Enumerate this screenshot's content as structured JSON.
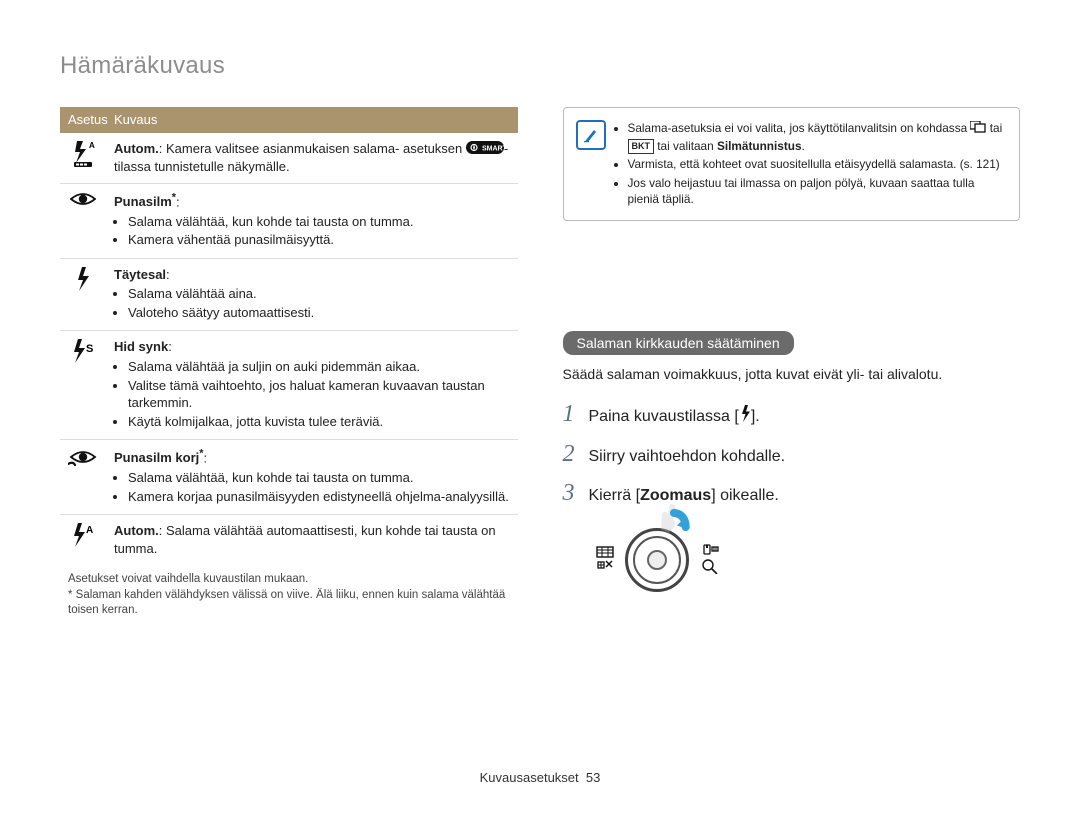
{
  "page_title": "Hämäräkuvaus",
  "table": {
    "head_option": "Asetus",
    "head_desc": "Kuvaus",
    "rows": {
      "auto": {
        "label": "Autom.",
        "text1": ": Kamera valitsee asianmukaisen salama- asetuksen ",
        "text2": "-tilassa tunnistetulle näkymälle."
      },
      "redeye": {
        "label": "Punasilm",
        "b1": "Salama välähtää, kun kohde tai tausta on tumma.",
        "b2": "Kamera vähentää punasilmäisyyttä."
      },
      "fill": {
        "label": "Täytesal",
        "b1": "Salama välähtää aina.",
        "b2": "Valoteho säätyy automaattisesti."
      },
      "slow": {
        "label": "Hid synk",
        "b1": "Salama välähtää ja suljin on auki pidemmän aikaa.",
        "b2": "Valitse tämä vaihtoehto, jos haluat kameran kuvaavan taustan tarkemmin.",
        "b3": "Käytä kolmijalkaa, jotta kuvista tulee teräviä."
      },
      "redeye_fix": {
        "label": "Punasilm korj",
        "b1": "Salama välähtää, kun kohde tai tausta on tumma.",
        "b2": "Kamera korjaa punasilmäisyyden edistyneellä ohjelma-analyysillä."
      },
      "auto2": {
        "label": "Autom.",
        "text": ": Salama välähtää automaattisesti, kun kohde tai tausta on tumma."
      }
    }
  },
  "footnotes": {
    "l1": "Asetukset voivat vaihdella kuvaustilan mukaan.",
    "l2": "* Salaman kahden välähdyksen välissä on viive. Älä liiku, ennen kuin salama välähtää toisen kerran."
  },
  "notebox": {
    "i1a": "Salama-asetuksia ei voi valita, jos käyttötilanvalitsin on kohdassa ",
    "i1b": " tai ",
    "i1c": " tai valitaan ",
    "i1d": "Silmätunnistus",
    "i1e": ".",
    "bkt": "BKT",
    "i2": "Varmista, että kohteet ovat suositellulla etäisyydellä salamasta. (s. 121)",
    "i3": "Jos valo heijastuu tai ilmassa on paljon pölyä, kuvaan saattaa tulla pieniä täpliä."
  },
  "subsection": {
    "pill": "Salaman kirkkauden säätäminen",
    "intro": "Säädä salaman voimakkuus, jotta kuvat eivät yli- tai alivalotu.",
    "step1a": "Paina kuvaustilassa [",
    "step1b": "].",
    "step2": "Siirry vaihtoehdon kohdalle.",
    "step3a": "Kierrä [",
    "step3b": "Zoomaus",
    "step3c": "] oikealle."
  },
  "nums": {
    "n1": "1",
    "n2": "2",
    "n3": "3"
  },
  "footer": {
    "label": "Kuvausasetukset",
    "page": "53"
  }
}
